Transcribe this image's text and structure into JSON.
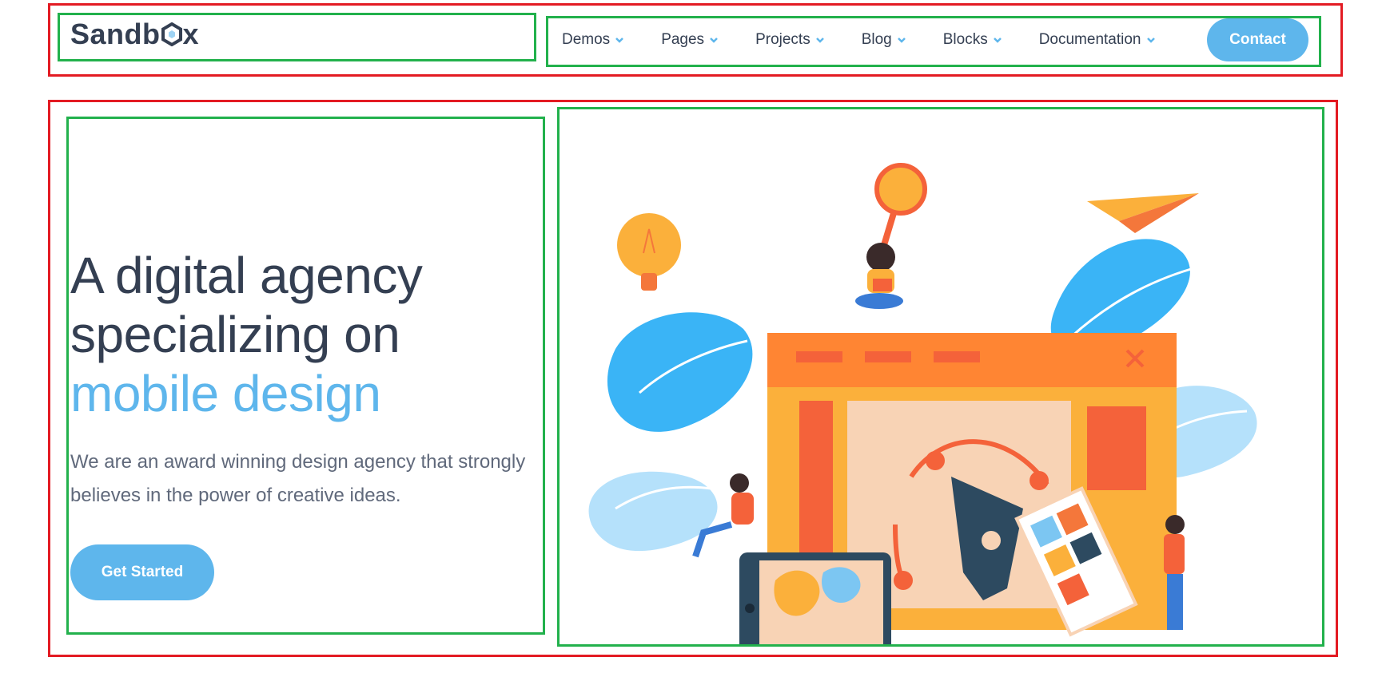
{
  "header": {
    "logo_text_before": "Sandb",
    "logo_text_after": "x",
    "nav": [
      {
        "label": "Demos"
      },
      {
        "label": "Pages"
      },
      {
        "label": "Projects"
      },
      {
        "label": "Blog"
      },
      {
        "label": "Blocks"
      },
      {
        "label": "Documentation"
      }
    ],
    "contact_label": "Contact"
  },
  "hero": {
    "headline_line1": "A digital agency",
    "headline_line2": "specializing on",
    "headline_accent": "mobile design",
    "lead": "We are an award winning design agency that strongly believes in the power of creative ideas.",
    "cta_label": "Get Started"
  },
  "colors": {
    "accent": "#5eb6ec",
    "dark_text": "#343f52",
    "annotation_red": "#e31b23",
    "annotation_green": "#22b14c"
  },
  "icons": [
    "hexagon-logo-icon",
    "chevron-down-icon",
    "lightbulb-icon",
    "magnifier-icon",
    "paper-plane-icon",
    "pen-tool-icon"
  ]
}
